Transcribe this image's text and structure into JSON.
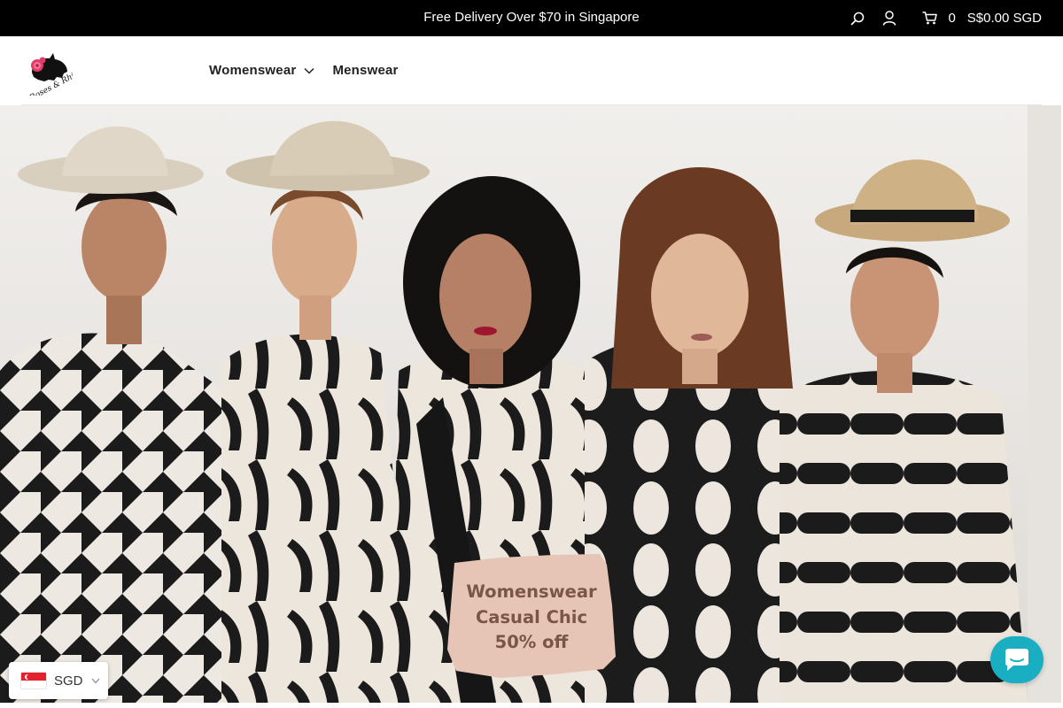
{
  "announcement": {
    "text": "Free Delivery Over $70 in Singapore"
  },
  "header_tools": {
    "search_icon": "search-icon",
    "account_icon": "user-icon",
    "cart_icon": "cart-icon",
    "cart_count": "0",
    "cart_total": "S$0.00 SGD"
  },
  "brand": {
    "logo_text": "Roses & Rhinos"
  },
  "nav": {
    "items": [
      {
        "label": "Womenswear",
        "has_dropdown": true
      },
      {
        "label": "Menswear",
        "has_dropdown": false
      }
    ]
  },
  "hero": {
    "promo_lines": [
      "Womenswear",
      "Casual Chic",
      "50% off"
    ]
  },
  "currency": {
    "code": "SGD",
    "flag": "singapore-flag"
  },
  "chat": {
    "icon": "chat-icon",
    "color": "#1aaec2"
  },
  "colors": {
    "topbar": "#000000",
    "promo_badge": "#e6c4b6",
    "promo_text": "#7a5548"
  }
}
